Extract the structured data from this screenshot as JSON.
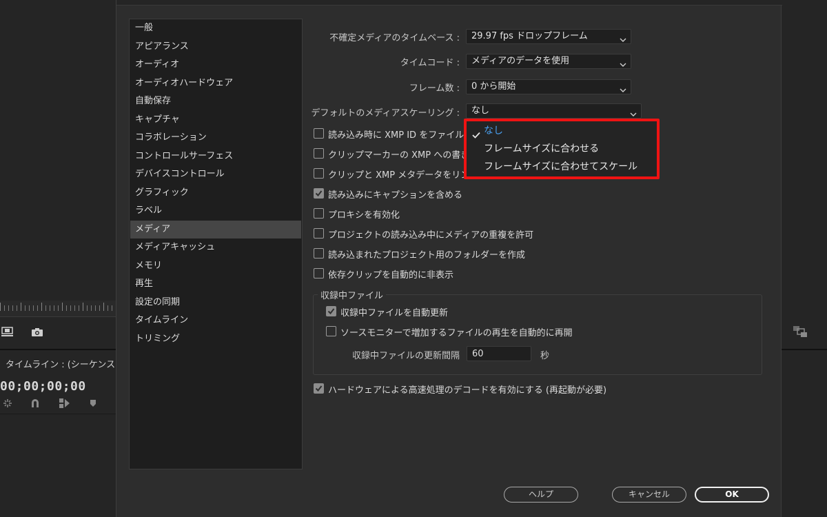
{
  "background": {
    "timeline_title": "タイムライン : (シーケンス",
    "timecode": "00;00;00;00",
    "tool_icons": [
      "ripple-icon",
      "magnet-icon",
      "linked-selection-icon",
      "marker-icon"
    ]
  },
  "dialog": {
    "sidebar": {
      "items": [
        {
          "label": "一般"
        },
        {
          "label": "アピアランス"
        },
        {
          "label": "オーディオ"
        },
        {
          "label": "オーディオハードウェア"
        },
        {
          "label": "自動保存"
        },
        {
          "label": "キャプチャ"
        },
        {
          "label": "コラボレーション"
        },
        {
          "label": "コントロールサーフェス"
        },
        {
          "label": "デバイスコントロール"
        },
        {
          "label": "グラフィック"
        },
        {
          "label": "ラベル"
        },
        {
          "label": "メディア"
        },
        {
          "label": "メディアキャッシュ"
        },
        {
          "label": "メモリ"
        },
        {
          "label": "再生"
        },
        {
          "label": "設定の同期"
        },
        {
          "label": "タイムライン"
        },
        {
          "label": "トリミング"
        }
      ],
      "selected": "メディア"
    },
    "fields": {
      "timebase_label": "不確定メディアのタイムベース :",
      "timebase_value": "29.97 fps ドロップフレーム",
      "timecode_label": "タイムコード :",
      "timecode_value": "メディアのデータを使用",
      "frame_count_label": "フレーム数 :",
      "frame_count_value": "0 から開始",
      "scaling_label": "デフォルトのメディアスケーリング :",
      "scaling_value": "なし"
    },
    "checkboxes": [
      {
        "label": "読み込み時に XMP ID をファイルに",
        "checked": false
      },
      {
        "label": "クリップマーカーの XMP への書き",
        "checked": false
      },
      {
        "label": "クリップと XMP メタデータをリン",
        "checked": false
      },
      {
        "label": "読み込みにキャプションを含める",
        "checked": true
      },
      {
        "label": "プロキシを有効化",
        "checked": false
      },
      {
        "label": "プロジェクトの読み込み中にメディアの重複を許可",
        "checked": false
      },
      {
        "label": "読み込まれたプロジェクト用のフォルダーを作成",
        "checked": false
      },
      {
        "label": "依存クリップを自動的に非表示",
        "checked": false
      }
    ],
    "growing_files": {
      "title": "収録中ファイル",
      "auto_refresh": {
        "label": "収録中ファイルを自動更新",
        "checked": true
      },
      "source_monitor": {
        "label": "ソースモニターで増加するファイルの再生を自動的に再開",
        "checked": false
      },
      "interval_label": "収録中ファイルの更新間隔",
      "interval_value": "60",
      "interval_unit": "秒"
    },
    "hardware_decode": {
      "label": "ハードウェアによる高速処理のデコードを有効にする (再起動が必要)",
      "checked": true
    },
    "buttons": {
      "help": "ヘルプ",
      "cancel": "キャンセル",
      "ok": "OK"
    },
    "scaling_dropdown": {
      "options": [
        "なし",
        "フレームサイズに合わせる",
        "フレームサイズに合わせてスケール"
      ],
      "selected": "なし",
      "highlight_color": "#ef1313",
      "selected_color": "#4aa0f0"
    }
  }
}
